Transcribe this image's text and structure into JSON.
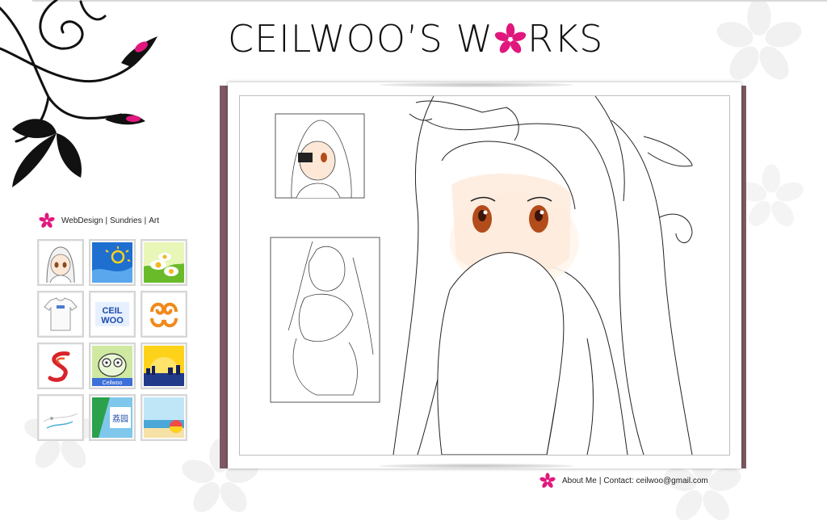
{
  "header": {
    "title_before": "CEILWOO’S W",
    "title_after": "RKS"
  },
  "nav": {
    "items": [
      {
        "label": "WebDesign"
      },
      {
        "label": "Sundries"
      },
      {
        "label": "Art"
      }
    ],
    "separator": "|"
  },
  "gallery": {
    "thumbnails": [
      {
        "name": "anime-girl-sketch"
      },
      {
        "name": "blue-sun-logo"
      },
      {
        "name": "daisy-flowers"
      },
      {
        "name": "white-tshirt"
      },
      {
        "name": "ceilwoo-logo",
        "text": "CEIL WOO"
      },
      {
        "name": "orange-swirl-logo"
      },
      {
        "name": "red-s-logo"
      },
      {
        "name": "ceilwoo-cat-face",
        "text": "Ceilwoo"
      },
      {
        "name": "city-sunset"
      },
      {
        "name": "white-card"
      },
      {
        "name": "chinese-poster",
        "text": "荔园"
      },
      {
        "name": "beach-ball"
      }
    ]
  },
  "footer": {
    "about_label": "About Me",
    "separator": "|",
    "contact_prefix": "Contact:",
    "email": "ceilwoo@gmail.com"
  },
  "colors": {
    "accent_pink": "#e0187d",
    "book_spine": "#7d5a63",
    "text": "#222222"
  }
}
